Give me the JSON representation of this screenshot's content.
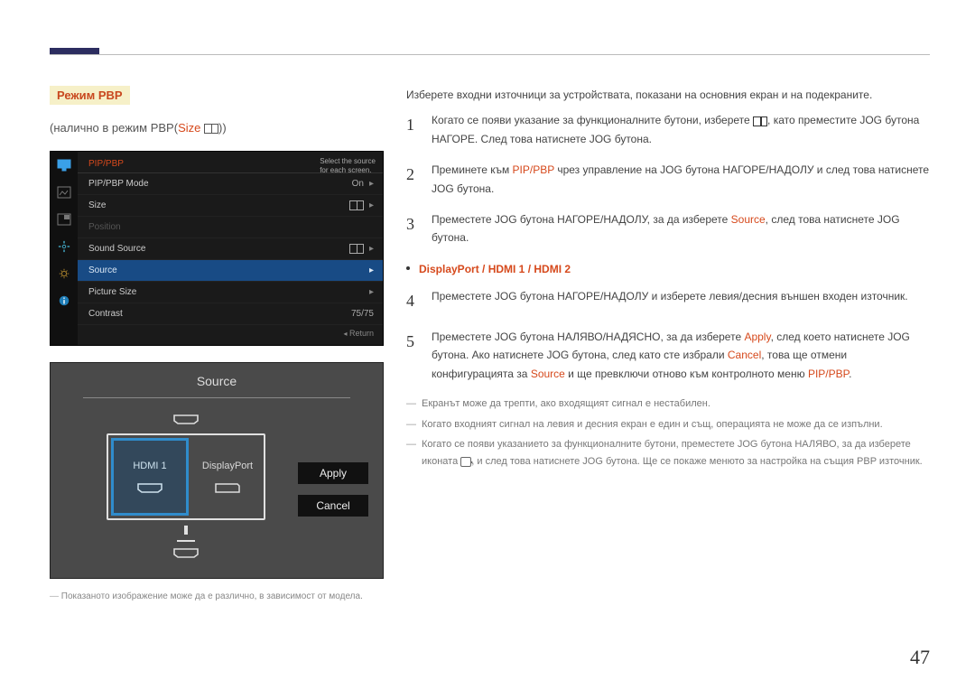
{
  "heading": "Режим PBP",
  "subtitle_prefix": "(налично в режим PBP(",
  "subtitle_size": "Size",
  "subtitle_suffix": "))",
  "osd": {
    "header": "PIP/PBP",
    "hint_line1": "Select the source",
    "hint_line2": "for each screen.",
    "rows": [
      {
        "label": "PIP/PBP Mode",
        "value": "On",
        "caret": "▸",
        "dim": false,
        "sel": false,
        "icon": false
      },
      {
        "label": "Size",
        "value": "",
        "caret": "▸",
        "dim": false,
        "sel": false,
        "icon": true
      },
      {
        "label": "Position",
        "value": "",
        "caret": "",
        "dim": true,
        "sel": false,
        "icon": false
      },
      {
        "label": "Sound Source",
        "value": "",
        "caret": "▸",
        "dim": false,
        "sel": false,
        "icon": true
      },
      {
        "label": "Source",
        "value": "",
        "caret": "▸",
        "dim": false,
        "sel": true,
        "icon": false
      },
      {
        "label": "Picture Size",
        "value": "",
        "caret": "▸",
        "dim": false,
        "sel": false,
        "icon": false
      },
      {
        "label": "Contrast",
        "value": "75/75",
        "caret": "",
        "dim": false,
        "sel": false,
        "icon": false
      }
    ],
    "return": "Return"
  },
  "source_panel": {
    "title": "Source",
    "left_label": "HDMI 1",
    "right_label": "DisplayPort",
    "apply": "Apply",
    "cancel": "Cancel"
  },
  "footnote": "Показаното изображение може да е различно, в зависимост от модела.",
  "right": {
    "intro": "Изберете входни източници за устройствата, показани на основния екран и на подекраните.",
    "steps": [
      "Когато се появи указание за функционалните бутони, изберете ⧉, като преместите JOG бутона НАГОРЕ. След това натиснете JOG бутона.",
      "Преминете към PIP/PBP чрез управление на JOG бутона НАГОРЕ/НАДОЛУ и след това натиснете JOG бутона.",
      "Преместете JOG бутона НАГОРЕ/НАДОЛУ, за да изберете Source, след това натиснете JOG бутона.",
      "Преместете JOG бутона НАГОРЕ/НАДОЛУ и изберете левия/десния външен входен източник.",
      "Преместете JOG бутона НАЛЯВО/НАДЯСНО, за да изберете Apply, след което натиснете JOG бутона. Ако натиснете JOG бутона, след като сте избрали Cancel, това ще отмени конфигурацията за Source и ще превключи отново към контролното меню PIP/PBP."
    ],
    "options_line": "DisplayPort / HDMI 1 / HDMI 2",
    "notes": [
      "Екранът може да трепти, ако входящият сигнал е нестабилен.",
      "Когато входният сигнал на левия и десния екран е един и същ, операцията не може да се изпълни.",
      "Когато се появи указанието за функционалните бутони, преместете JOG бутона НАЛЯВО, за да изберете иконата ↺, и след това натиснете JOG бутона. Ще се покаже менюто за настройка на същия PBP източник."
    ]
  },
  "page_number": "47"
}
